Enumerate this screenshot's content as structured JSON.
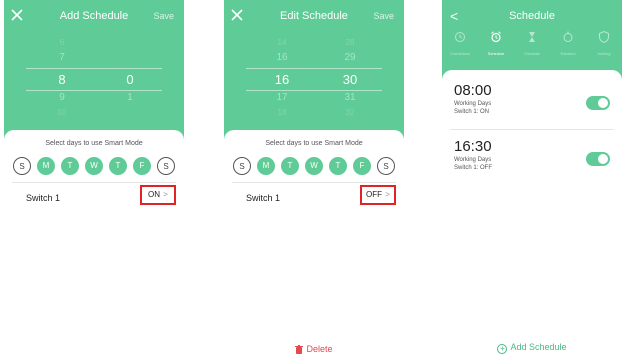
{
  "screen1": {
    "title": "Add Schedule",
    "save": "Save",
    "picker": {
      "hours": [
        "6",
        "7",
        "8",
        "9",
        "10"
      ],
      "minutes": [
        "",
        "",
        "0",
        "1",
        ""
      ]
    },
    "days_prompt": "Select days to use Smart Mode",
    "days": [
      {
        "label": "S",
        "selected": false
      },
      {
        "label": "M",
        "selected": true
      },
      {
        "label": "T",
        "selected": true
      },
      {
        "label": "W",
        "selected": true
      },
      {
        "label": "T",
        "selected": true
      },
      {
        "label": "F",
        "selected": true
      },
      {
        "label": "S",
        "selected": false
      }
    ],
    "switch_label": "Switch 1",
    "switch_value": "ON",
    "chevron": ">"
  },
  "screen2": {
    "title": "Edit Schedule",
    "save": "Save",
    "picker": {
      "hours": [
        "14",
        "16",
        "16",
        "17",
        "18"
      ],
      "minutes": [
        "28",
        "29",
        "30",
        "31",
        "32"
      ]
    },
    "days_prompt": "Select days to use Smart Mode",
    "days": [
      {
        "label": "S",
        "selected": false
      },
      {
        "label": "M",
        "selected": true
      },
      {
        "label": "T",
        "selected": true
      },
      {
        "label": "W",
        "selected": true
      },
      {
        "label": "T",
        "selected": true
      },
      {
        "label": "F",
        "selected": true
      },
      {
        "label": "S",
        "selected": false
      }
    ],
    "switch_label": "Switch 1",
    "switch_value": "OFF",
    "chevron": ">",
    "delete": "Delete"
  },
  "screen3": {
    "back": "<",
    "title": "Schedule",
    "tabs": [
      {
        "label": "Countdown",
        "icon": "clock-icon",
        "active": false
      },
      {
        "label": "Schedule",
        "icon": "alarm-icon",
        "active": true
      },
      {
        "label": "Circulate",
        "icon": "hourglass-icon",
        "active": false
      },
      {
        "label": "Random",
        "icon": "random-icon",
        "active": false
      },
      {
        "label": "Inching",
        "icon": "shield-icon",
        "active": false
      }
    ],
    "schedules": [
      {
        "time": "08:00",
        "days": "Working Days",
        "status": "Switch 1: ON",
        "enabled": true
      },
      {
        "time": "16:30",
        "days": "Working Days",
        "status": "Switch 1: OFF",
        "enabled": true
      }
    ],
    "add": "Add Schedule"
  },
  "colors": {
    "brand": "#5fcb97",
    "highlight_border": "#e02424",
    "delete": "#e5484d"
  }
}
